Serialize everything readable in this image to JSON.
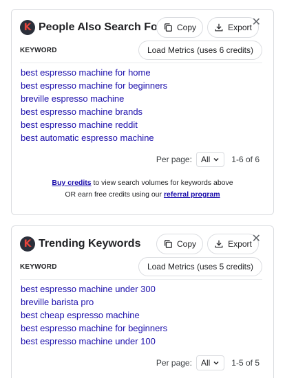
{
  "panels": [
    {
      "logo_letter": "K",
      "title": "People Also Search For",
      "copy_label": "Copy",
      "export_label": "Export",
      "close_glyph": "✕",
      "column_header": "KEYWORD",
      "metrics_label": "Load Metrics (uses 6 credits)",
      "keywords": [
        "best espresso machine for home",
        "best espresso machine for beginners",
        "breville espresso machine",
        "best espresso machine brands",
        "best espresso machine reddit",
        "best automatic espresso machine"
      ],
      "per_page_label": "Per page:",
      "per_page_value": "All",
      "range_text": "1-6 of 6",
      "credits_link": "Buy credits",
      "credits_text_1": " to view search volumes for keywords above",
      "credits_text_2": "OR earn free credits using our ",
      "referral_link": "referral program"
    },
    {
      "logo_letter": "K",
      "title": "Trending Keywords",
      "copy_label": "Copy",
      "export_label": "Export",
      "close_glyph": "✕",
      "column_header": "KEYWORD",
      "metrics_label": "Load Metrics (uses 5 credits)",
      "keywords": [
        "best espresso machine under 300",
        "breville barista pro",
        "best cheap espresso machine",
        "best espresso machine for beginners",
        "best espresso machine under 100"
      ],
      "per_page_label": "Per page:",
      "per_page_value": "All",
      "range_text": "1-5 of 5"
    }
  ],
  "colors": {
    "link": "#1a0dab",
    "logo_bg": "#2b2f3a",
    "logo_letter": "#e8453c",
    "border": "#dadce0"
  },
  "icons": {
    "copy": "copy-icon",
    "export": "download-icon",
    "close": "close-icon",
    "dropdown": "chevron-down-icon"
  }
}
